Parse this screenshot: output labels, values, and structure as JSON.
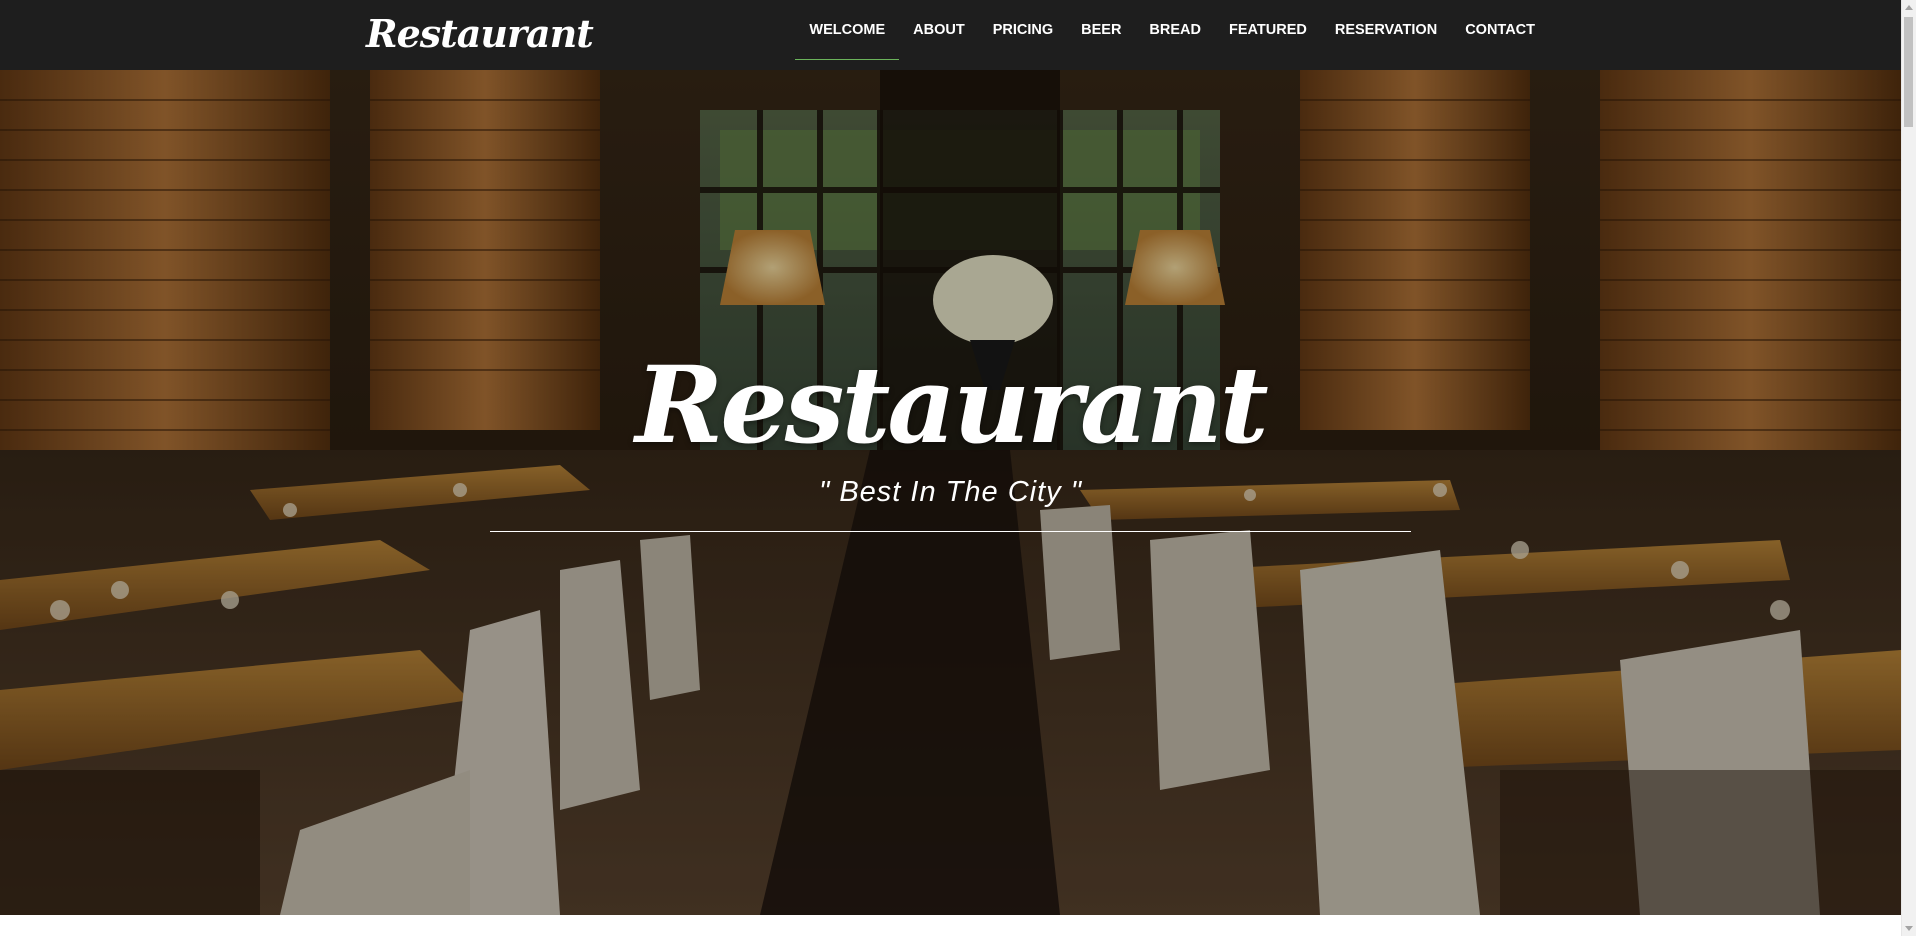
{
  "navbar": {
    "brand": "Restaurant",
    "items": [
      {
        "label": "WELCOME",
        "active": true
      },
      {
        "label": "ABOUT",
        "active": false
      },
      {
        "label": "PRICING",
        "active": false
      },
      {
        "label": "BEER",
        "active": false
      },
      {
        "label": "BREAD",
        "active": false
      },
      {
        "label": "FEATURED",
        "active": false
      },
      {
        "label": "RESERVATION",
        "active": false
      },
      {
        "label": "CONTACT",
        "active": false
      }
    ],
    "active_underline_color": "#6bb35b",
    "background": "#1e1e1e"
  },
  "hero": {
    "title": "Restaurant",
    "tagline": "\" Best In The City \"",
    "background_image": "restaurant-interior-photo"
  }
}
